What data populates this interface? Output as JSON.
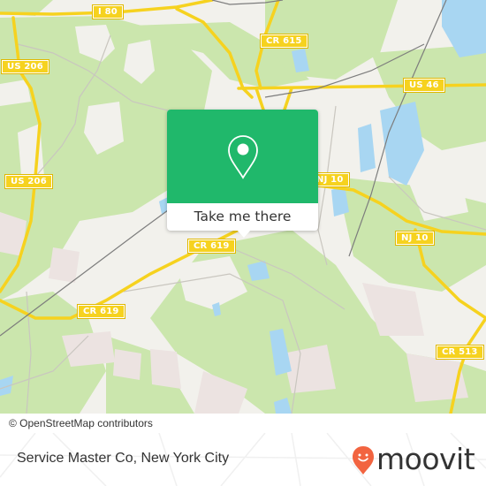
{
  "map": {
    "road_labels": [
      {
        "id": "i80",
        "text": "I 80"
      },
      {
        "id": "us206-north",
        "text": "US 206"
      },
      {
        "id": "us206-south",
        "text": "US 206"
      },
      {
        "id": "cr615",
        "text": "CR 615"
      },
      {
        "id": "us46",
        "text": "US 46"
      },
      {
        "id": "nj10-west",
        "text": "NJ 10"
      },
      {
        "id": "nj10-east",
        "text": "NJ 10"
      },
      {
        "id": "cr619-east",
        "text": "CR 619"
      },
      {
        "id": "cr619-west",
        "text": "CR 619"
      },
      {
        "id": "cr513",
        "text": "CR 513"
      }
    ],
    "colors": {
      "land": "#f2f1ec",
      "forest": "#cbe6ad",
      "water": "#a8d6f2",
      "road_major": "#f6d21f",
      "residential": "#ece3e1"
    }
  },
  "popup": {
    "icon": "map-pin-icon",
    "action_label": "Take me there",
    "accent_color": "#20b86b"
  },
  "attribution": "© OpenStreetMap contributors",
  "footer": {
    "place_name": "Service Master Co, New York City",
    "brand": "moovit",
    "brand_icon": "moovit-smiley-pin-icon",
    "brand_color": "#f26440"
  }
}
